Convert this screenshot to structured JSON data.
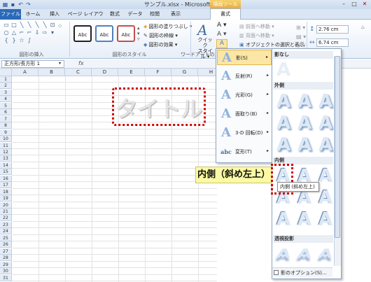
{
  "window": {
    "title": "サンプル.xlsx - Microsoft Excel",
    "context_tab_group": "描画ツール"
  },
  "tabs": [
    "ファイル",
    "ホーム",
    "挿入",
    "ページ レイアウト",
    "数式",
    "データ",
    "校閲",
    "表示",
    "書式"
  ],
  "ribbon": {
    "groups": {
      "insert_shapes": "図形の挿入",
      "shape_styles": "図形のスタイル",
      "wordart_styles": "ワードアートのスタイル"
    },
    "style_boxes": [
      "Abc",
      "Abc",
      "Abc"
    ],
    "shape_fill": "図形の塗りつぶし",
    "shape_outline": "図形の枠線",
    "shape_effects": "図形の効果",
    "quick_styles": [
      "クイック",
      "スタイル"
    ],
    "bring_forward": "前面へ移動",
    "send_backward": "背面へ移動",
    "selection_pane": "オブジェクトの選択と表示",
    "height": "2.76 cm",
    "width": "6.74 cm"
  },
  "formula_bar": {
    "name_box": "正方形/長方形 1",
    "fx": "fx"
  },
  "sheet": {
    "columns": [
      "A",
      "B",
      "C",
      "D",
      "E",
      "F",
      "G",
      "H"
    ],
    "rows": [
      "1",
      "2",
      "3",
      "4",
      "5",
      "6",
      "7",
      "8",
      "9",
      "10",
      "11",
      "12",
      "13",
      "14",
      "15",
      "16",
      "17",
      "18",
      "19",
      "20",
      "21",
      "22",
      "23",
      "24",
      "25",
      "26",
      "27",
      "28",
      "29",
      "30",
      "31"
    ],
    "shape_text": "タイトル"
  },
  "effects_menu": {
    "items": [
      {
        "label": "影(S)",
        "icon": "A"
      },
      {
        "label": "反射(R)",
        "icon": "A"
      },
      {
        "label": "光彩(G)",
        "icon": "A"
      },
      {
        "label": "面取り(B)",
        "icon": "A"
      },
      {
        "label": "3-D 回転(D)",
        "icon": "A"
      },
      {
        "label": "変形(T)",
        "icon": "abc"
      }
    ]
  },
  "gallery": {
    "sections": [
      "影なし",
      "外側",
      "内側",
      "透視投影"
    ],
    "glyph": "A",
    "shadow_options": "影のオプション(S)..."
  },
  "callout": "内側（斜め左上）",
  "tooltip": "内側 (斜め左上)"
}
